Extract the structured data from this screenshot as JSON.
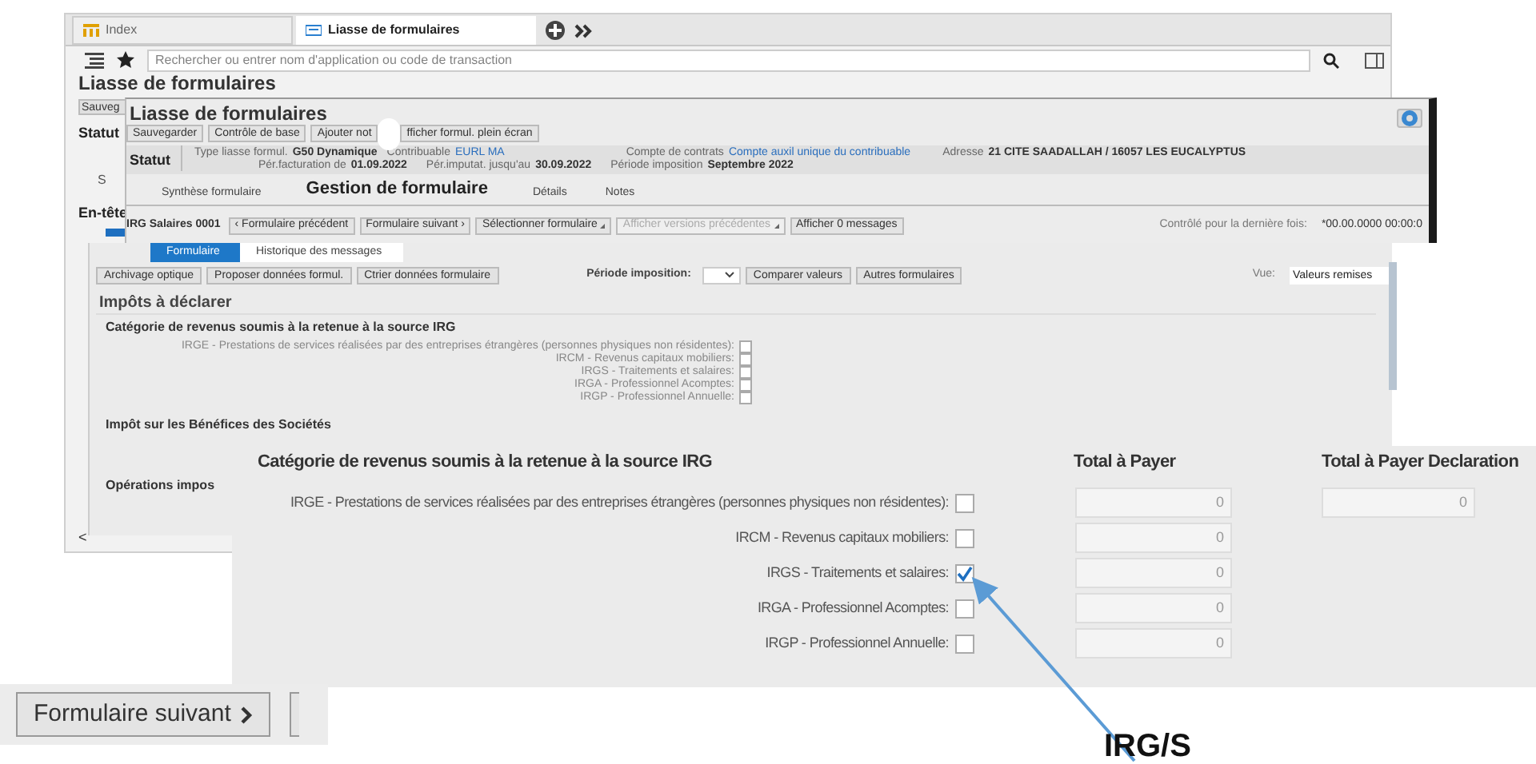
{
  "back_window": {
    "tabs": [
      {
        "label": "Index",
        "selected": false
      },
      {
        "label": "Liasse de formulaires",
        "selected": true
      }
    ],
    "search": {
      "placeholder": "Rechercher ou entrer nom d'application ou code de transaction"
    },
    "title": "Liasse de formulaires",
    "scroll_label": "<",
    "fragments": [
      {
        "kind": "button",
        "text": "Sauveg"
      },
      {
        "kind": "label",
        "text": "Statut"
      },
      {
        "kind": "tab",
        "text": "S"
      },
      {
        "kind": "label",
        "text": "En-tête"
      }
    ]
  },
  "window": {
    "title": "Liasse de formulaires",
    "toolbar": [
      "Sauvegarder",
      "Contrôle de base",
      "Ajouter not",
      "fficher formul. plein écran"
    ],
    "status": {
      "label": "Statut",
      "fields": [
        {
          "label": "Type liasse formul.",
          "value": "G50 Dynamique",
          "kind": "plain"
        },
        {
          "label": "Contribuable",
          "value": "EURL MA",
          "kind": "link"
        },
        {
          "label": "Compte de contrats",
          "value": "Compte auxil unique du contribuable",
          "kind": "link"
        },
        {
          "label": "Adresse",
          "value": "21 CITE SAADALLAH / 16057 LES EUCALYPTUS",
          "kind": "plain"
        }
      ],
      "fields2": [
        {
          "label": "Pér.facturation de",
          "value": "01.09.2022"
        },
        {
          "label": "Pér.imputat. jusqu'au",
          "value": "30.09.2022"
        },
        {
          "label": "Période imposition",
          "value": "Septembre 2022"
        }
      ]
    },
    "tabs": [
      {
        "label": "Synthèse formulaire",
        "selected": false
      },
      {
        "label": "Gestion de formulaire",
        "selected": true
      },
      {
        "label": "Détails",
        "selected": false
      },
      {
        "label": "Notes",
        "selected": false
      }
    ],
    "form_bar": {
      "title": "IRG Salaires 0001",
      "buttons": [
        {
          "label": "‹ Formulaire précédent",
          "disabled": false
        },
        {
          "label": "Formulaire suivant ›",
          "disabled": false
        },
        {
          "label": "Sélectionner formulaire",
          "disabled": false,
          "menu": true
        },
        {
          "label": "Afficher versions précédentes",
          "disabled": true,
          "menu": true
        },
        {
          "label": "Afficher 0 messages",
          "disabled": false
        }
      ],
      "checked_label": "Contrôlé pour la dernière fois:",
      "checked_value": "*00.00.0000 00:00:0"
    }
  },
  "form_panel": {
    "tabs": [
      {
        "label": "Formulaire",
        "selected": true
      },
      {
        "label": "Historique des messages",
        "selected": false
      }
    ],
    "buttons": [
      "Archivage optique",
      "Proposer données formul.",
      "Ctrier données formulaire"
    ],
    "period_label": "Période imposition:",
    "buttons2": [
      "Comparer valeurs",
      "Autres formulaires"
    ],
    "view_label": "Vue:",
    "view_value": "Valeurs remises",
    "heading": "Impôts à déclarer",
    "section": "Catégorie de revenus soumis à la retenue à la source IRG",
    "rows": [
      {
        "label": "IRGE - Prestations de services réalisées par des entreprises étrangères (personnes physiques non résidentes):",
        "checked": false
      },
      {
        "label": "IRCM - Revenus capitaux mobiliers:",
        "checked": false
      },
      {
        "label": "IRGS - Traitements et salaires:",
        "checked": false
      },
      {
        "label": "IRGA - Professionnel Acomptes:",
        "checked": false
      },
      {
        "label": "IRGP - Professionnel Annuelle:",
        "checked": false
      }
    ],
    "section2": "Impôt sur les Bénéfices des Sociétés",
    "section3": "Opérations impos"
  },
  "zoom_panel": {
    "columns": [
      "Catégorie de revenus soumis à la retenue à la source IRG",
      "Total à Payer",
      "Total à Payer Declaration"
    ],
    "rows": [
      {
        "label": "IRGE - Prestations de services réalisées par des entreprises étrangères (personnes physiques non résidentes):",
        "checked": false,
        "total": "0",
        "declaration": "0"
      },
      {
        "label": "IRCM - Revenus capitaux mobiliers:",
        "checked": false,
        "total": "0"
      },
      {
        "label": "IRGS - Traitements et salaires:",
        "checked": true,
        "total": "0"
      },
      {
        "label": "IRGA - Professionnel Acomptes:",
        "checked": false,
        "total": "0"
      },
      {
        "label": "IRGP - Professionnel Annuelle:",
        "checked": false,
        "total": "0"
      }
    ]
  },
  "zoom_button": {
    "label": "Formulaire suivant"
  },
  "annotation": {
    "label": "IRG/S"
  }
}
